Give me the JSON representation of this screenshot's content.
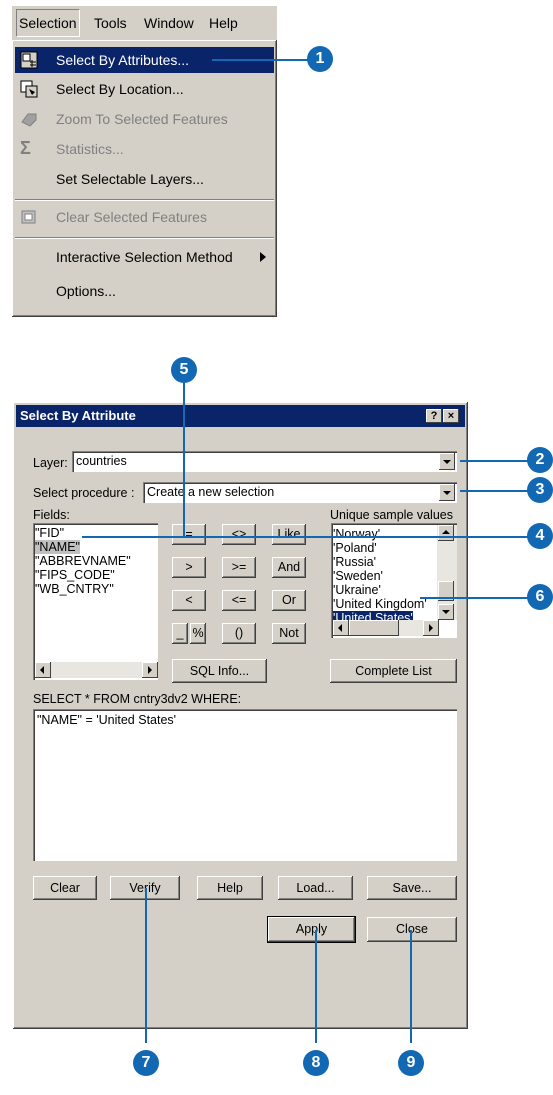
{
  "menubar": {
    "items": [
      "Selection",
      "Tools",
      "Window",
      "Help"
    ]
  },
  "menu": {
    "items": [
      {
        "label": "Select By Attributes...",
        "icon": "select-by-attributes-icon",
        "state": "highlighted"
      },
      {
        "label": "Select By Location...",
        "icon": "select-by-location-icon",
        "state": "enabled"
      },
      {
        "label": "Zoom To Selected Features",
        "icon": "zoom-to-selected-icon",
        "state": "disabled"
      },
      {
        "label": "Statistics...",
        "icon": "sigma-icon",
        "state": "disabled"
      },
      {
        "label": "Set Selectable Layers...",
        "state": "enabled"
      },
      {
        "label": "Clear Selected Features",
        "icon": "clear-selected-icon",
        "state": "disabled"
      },
      {
        "label": "Interactive Selection Method",
        "state": "enabled",
        "submenu": true
      },
      {
        "label": "Options...",
        "state": "enabled"
      }
    ]
  },
  "dialog": {
    "title": "Select By Attribute",
    "help_btn": "?",
    "close_btn": "×",
    "layer_label": "Layer:",
    "layer_value": "countries",
    "procedure_label": "Select procedure :",
    "procedure_value": "Create a new selection",
    "fields_label": "Fields:",
    "fields": [
      "\"FID\"",
      "\"NAME\"",
      "\"ABBREVNAME\"",
      "\"FIPS_CODE\"",
      "\"WB_CNTRY\""
    ],
    "selected_field": "\"NAME\"",
    "operators": [
      "=",
      "<>",
      "Like",
      ">",
      ">=",
      "And",
      "<",
      "<=",
      "Or",
      "_",
      "%",
      "()",
      "Not"
    ],
    "sql_info": "SQL Info...",
    "unique_label": "Unique sample values",
    "unique_values": [
      "'Norway'",
      "'Poland'",
      "'Russia'",
      "'Sweden'",
      "'Ukraine'",
      "'United Kingdom'",
      "'United States'"
    ],
    "selected_value": "'United States'",
    "complete_list": "Complete List",
    "where_label": "SELECT * FROM cntry3dv2 WHERE:",
    "expression": "\"NAME\" = 'United States'",
    "buttons": {
      "clear": "Clear",
      "verify": "Verify",
      "help": "Help",
      "load": "Load...",
      "save": "Save...",
      "apply": "Apply",
      "close": "Close"
    }
  },
  "callouts": [
    "1",
    "2",
    "3",
    "4",
    "5",
    "6",
    "7",
    "8",
    "9"
  ],
  "colors": {
    "callout": "#1268b3",
    "highlight": "#0a246a",
    "face": "#d4d0c8"
  }
}
